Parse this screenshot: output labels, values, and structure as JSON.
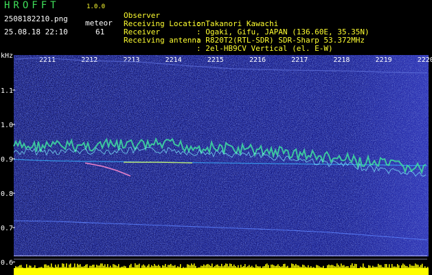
{
  "header": {
    "logo": "HROFFT",
    "version": "1.0.0",
    "filename": "2508182210.png",
    "meteor_label": "meteor",
    "datetime": "25.08.18 22:10",
    "meteor_count": "61"
  },
  "info": [
    {
      "key": "Observer",
      "value": ": Takanori Kawachi"
    },
    {
      "key": "Receiving Location",
      "value": ": Ogaki, Gifu, JAPAN (136.60E, 35.35N)"
    },
    {
      "key": "Receiver",
      "value": ": R820T2(RTL-SDR) SDR-Sharp 53.372MHz"
    },
    {
      "key": "Receiving antenna",
      "value": ": 2el-HB9CV Vertical (el. E-W)"
    }
  ],
  "chart_data": {
    "type": "heatmap",
    "y_unit": "kHz",
    "y_ticks": [
      "1.1",
      "1.0",
      "0.9",
      "0.8",
      "0.7",
      "0.6"
    ],
    "x_ticks": [
      "2211",
      "2212",
      "2213",
      "2214",
      "2215",
      "2216",
      "2217",
      "2218",
      "2219",
      "2220"
    ],
    "ylim": [
      0.6,
      1.2
    ]
  },
  "colors": {
    "background": "#000000",
    "spectrogram_base": "#10106a",
    "signal": "#40e0a0",
    "text_green": "#3fe05a",
    "text_yellow": "#ffff30",
    "bar_yellow": "#ffff00"
  }
}
